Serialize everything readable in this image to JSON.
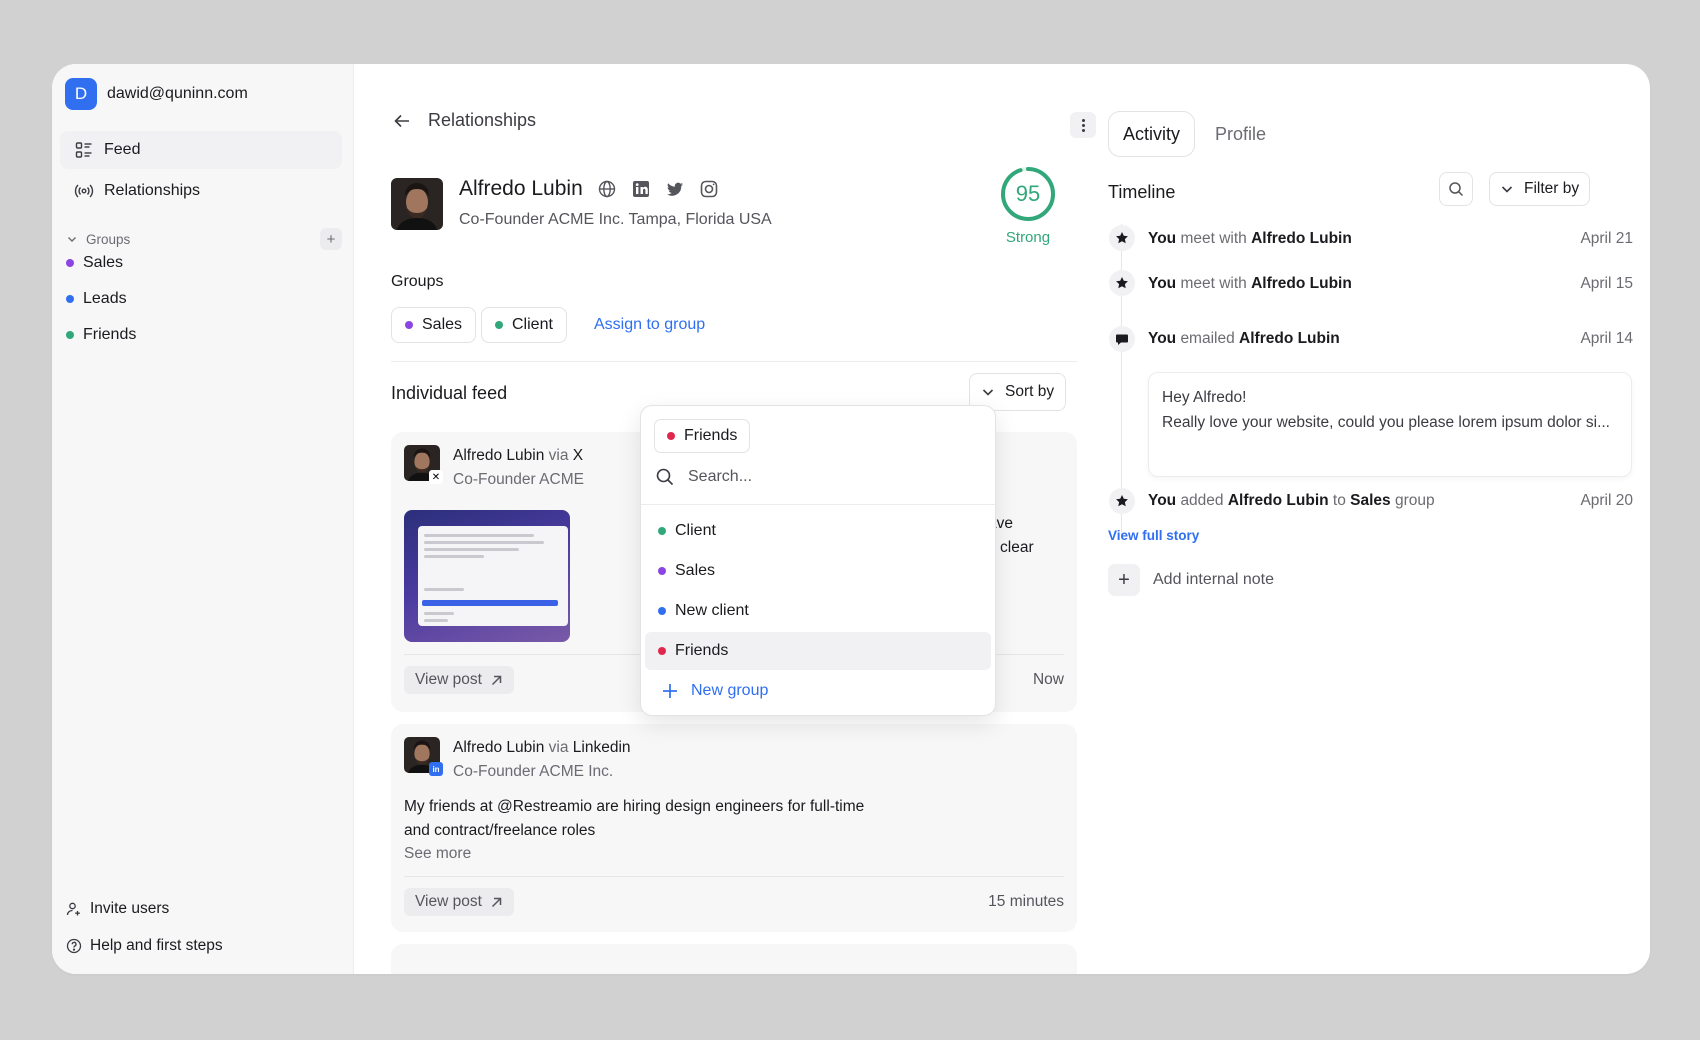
{
  "account": {
    "initial": "D",
    "email": "dawid@quninn.com"
  },
  "nav": {
    "feed": "Feed",
    "relationships": "Relationships"
  },
  "sidebar_groups": {
    "title": "Groups",
    "items": [
      {
        "label": "Sales",
        "color": "#8b45e3"
      },
      {
        "label": "Leads",
        "color": "#2f6ff0"
      },
      {
        "label": "Friends",
        "color": "#31a77a"
      }
    ]
  },
  "sidebar_bottom": {
    "invite": "Invite users",
    "help": "Help and first steps"
  },
  "header": {
    "title": "Relationships"
  },
  "contact": {
    "name": "Alfredo Lubin",
    "subtitle": "Co-Founder ACME Inc. Tampa, Florida USA",
    "score": "95",
    "score_fraction": 0.95,
    "score_label": "Strong"
  },
  "groups": {
    "title": "Groups",
    "chips": [
      {
        "label": "Sales",
        "color": "#8b45e3"
      },
      {
        "label": "Client",
        "color": "#31a77a"
      }
    ],
    "assign": "Assign to group"
  },
  "feed": {
    "title": "Individual feed",
    "sort": "Sort by",
    "posts": [
      {
        "author": "Alfredo Lubin",
        "via": "via",
        "source": "X",
        "subtitle": "Co-Founder ACME",
        "text1": "- You now have",
        "text2": "dual chats or clear",
        "view": "View post",
        "time": "Now"
      },
      {
        "author": "Alfredo Lubin",
        "via": "via",
        "source": "Linkedin",
        "subtitle": "Co-Founder ACME Inc.",
        "text": "My friends at @Restreamio are hiring design engineers for full-time and contract/freelance roles",
        "more": "See more",
        "view": "View post",
        "time": "15 minutes"
      }
    ]
  },
  "dropdown": {
    "selected": {
      "label": "Friends",
      "color": "#e0284f"
    },
    "search_placeholder": "Search...",
    "options": [
      {
        "label": "Client",
        "color": "#31a77a"
      },
      {
        "label": "Sales",
        "color": "#8b45e3"
      },
      {
        "label": "New client",
        "color": "#2f6ff0"
      },
      {
        "label": "Friends",
        "color": "#e0284f"
      }
    ],
    "new_group": "New group"
  },
  "right": {
    "tabs": [
      "Activity",
      "Profile"
    ],
    "timeline_title": "Timeline",
    "filter": "Filter by",
    "events": [
      {
        "you": "You",
        "verb": "meet with",
        "target": "Alfredo Lubin",
        "date": "April 21"
      },
      {
        "you": "You",
        "verb": "meet with",
        "target": "Alfredo Lubin",
        "date": "April 15"
      },
      {
        "you": "You",
        "verb": "emailed",
        "target": "Alfredo Lubin",
        "date": "April 14"
      },
      {
        "you": "You",
        "verb": "added",
        "target": "Alfredo Lubin",
        "to": "to",
        "group": "Sales",
        "suffix": "group",
        "date": "April 20"
      }
    ],
    "email": {
      "greeting": "Hey Alfredo!",
      "body": "Really love your website, could you please lorem ipsum dolor si..."
    },
    "view_story": "View full story",
    "add_note": "Add internal note"
  }
}
